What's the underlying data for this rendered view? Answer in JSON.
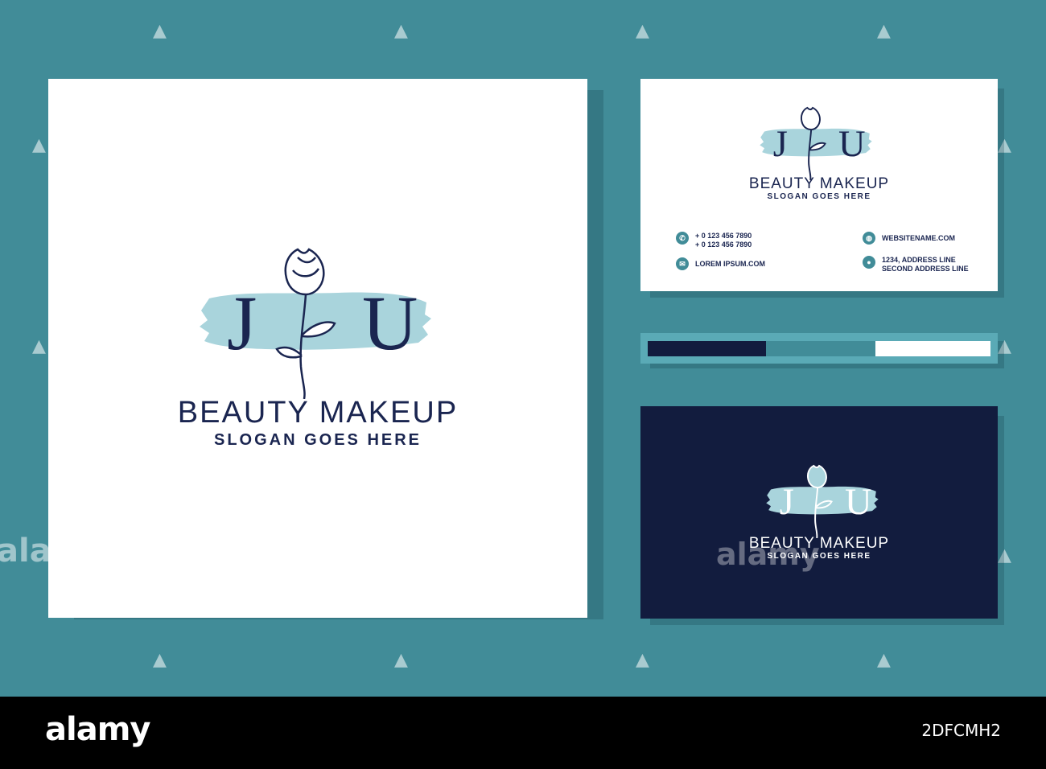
{
  "brand": {
    "monogram_left": "J",
    "monogram_right": "U",
    "name": "BEAUTY MAKEUP",
    "slogan": "SLOGAN GOES HERE"
  },
  "contacts": {
    "phone_lines": [
      "+ 0 123 456 7890",
      "+ 0 123 456 7890"
    ],
    "email": "LOREM IPSUM.COM",
    "website": "WEBSITENAME.COM",
    "address_lines": [
      "1234, ADDRESS LINE",
      "SECOND ADDRESS LINE"
    ]
  },
  "icons": {
    "phone": "phone-icon",
    "email": "email-icon",
    "website": "globe-icon",
    "address": "location-pin-icon"
  },
  "colors": {
    "background": "#418c98",
    "navy": "#121c3e",
    "brush": "#a9d4dc",
    "white": "#ffffff",
    "teal_light": "#5aaab6"
  },
  "watermark": {
    "word": "alamy",
    "stock_id": "2DFCMH2"
  }
}
